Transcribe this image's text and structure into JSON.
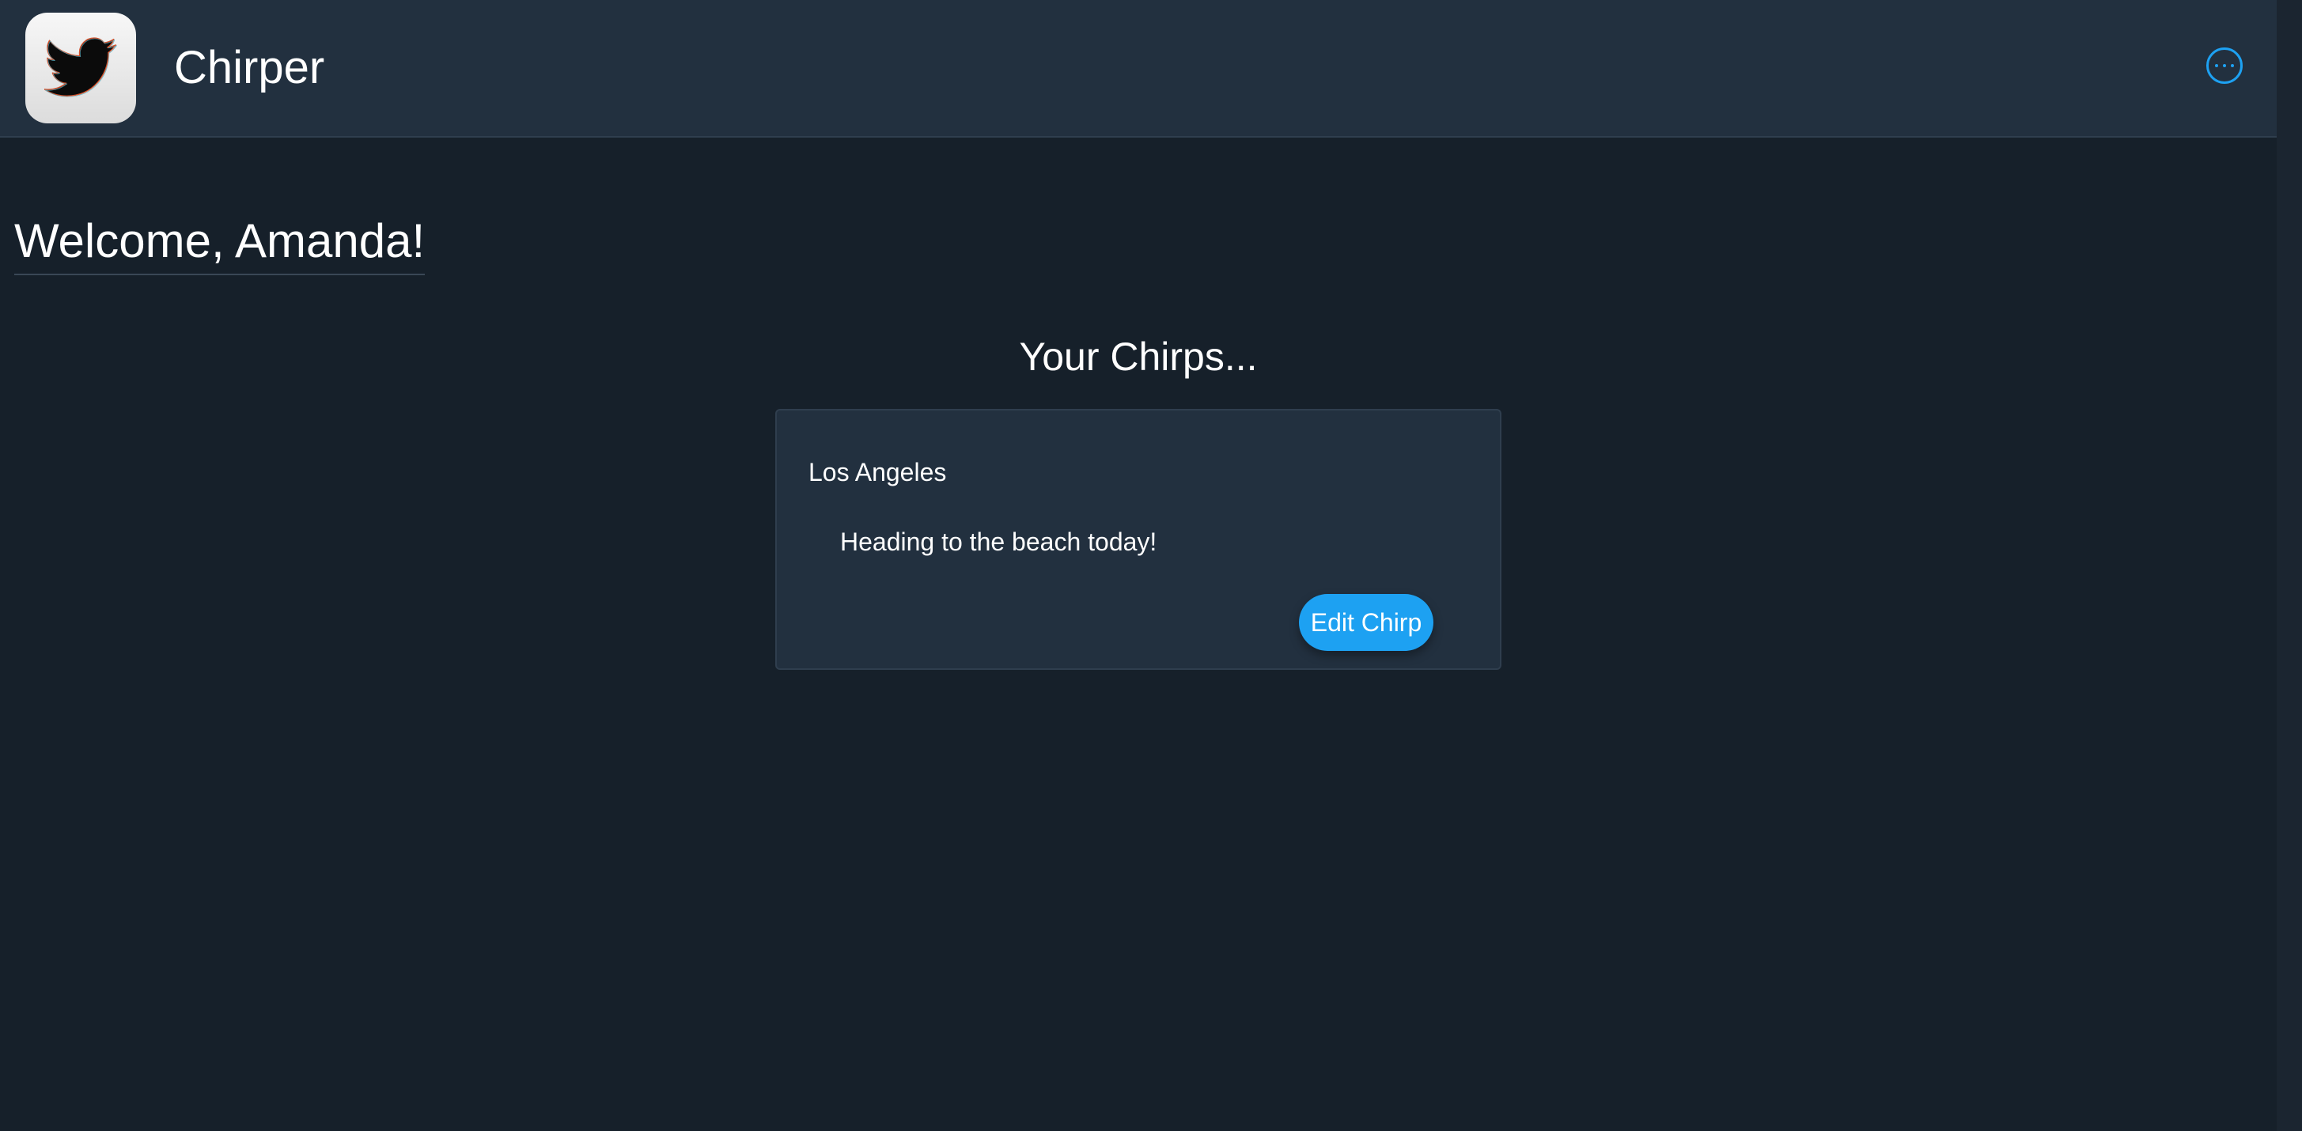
{
  "header": {
    "app_title": "Chirper",
    "logo_icon": "twitter-bird-icon",
    "menu_icon": "more-horizontal-circle-icon"
  },
  "main": {
    "welcome_text": "Welcome, Amanda!",
    "section_title": "Your Chirps...",
    "chirps": [
      {
        "location": "Los Angeles",
        "text": "Heading to the beach today!",
        "edit_label": "Edit Chirp"
      }
    ]
  },
  "colors": {
    "background": "#16202a",
    "header_background": "#22303f",
    "card_background": "#22303f",
    "accent": "#1da1f2"
  }
}
